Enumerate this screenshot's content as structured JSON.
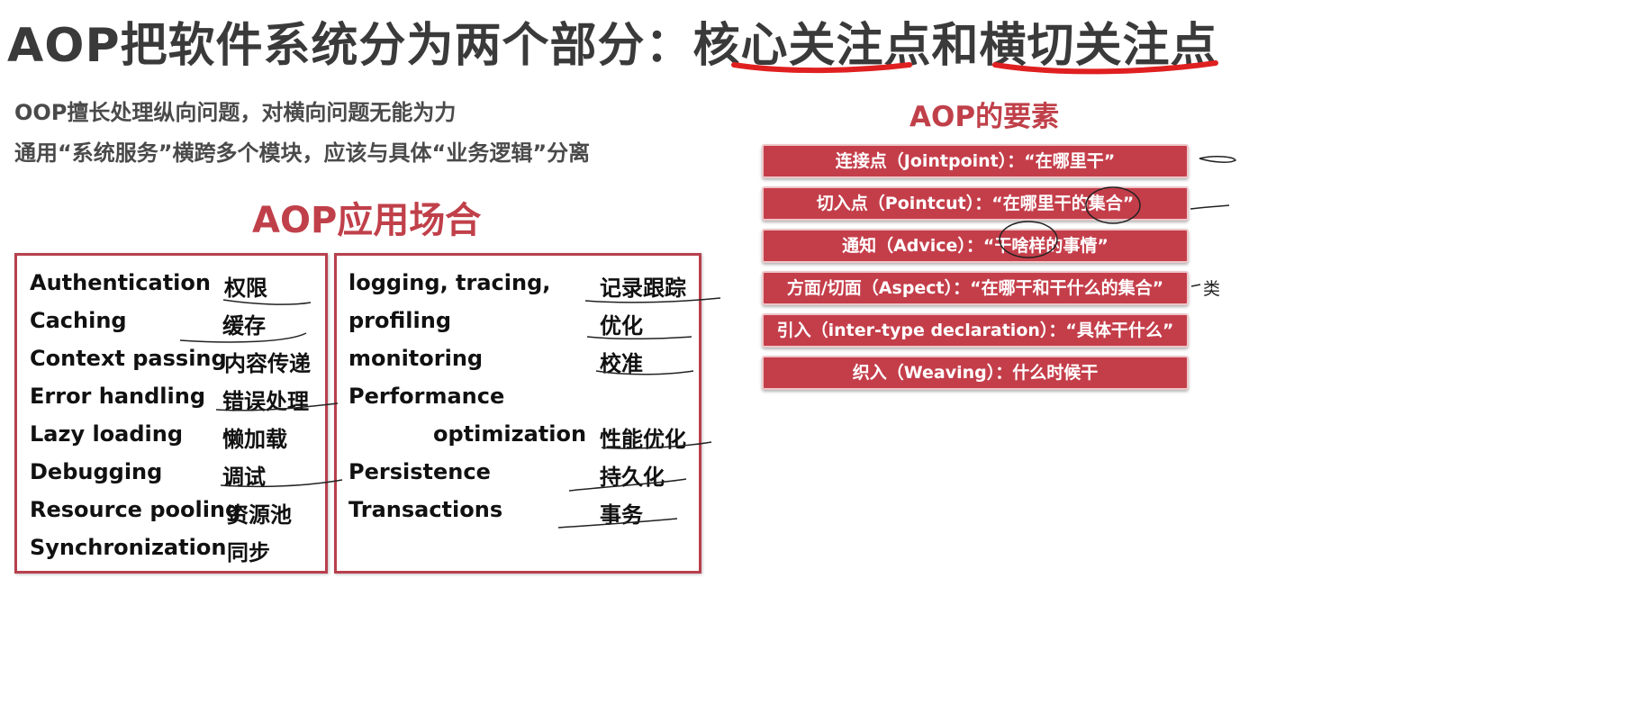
{
  "title": "AOP把软件系统分为两个部分：核心关注点和横切关注点",
  "intro": [
    "OOP擅长处理纵向问题，对横向问题无能为力",
    "通用“系统服务”横跨多个模块，应该与具体“业务逻辑”分离"
  ],
  "applications": {
    "heading": "AOP应用场合",
    "left": [
      {
        "en": "Authentication",
        "cn": "权限"
      },
      {
        "en": "Caching",
        "cn": "缓存"
      },
      {
        "en": "Context passing",
        "cn": "内容传递"
      },
      {
        "en": "Error handling",
        "cn": "错误处理"
      },
      {
        "en": "Lazy loading",
        "cn": "懒加载"
      },
      {
        "en": "Debugging",
        "cn": "调试"
      },
      {
        "en": "Resource pooling",
        "cn": "资源池"
      },
      {
        "en": "Synchronization",
        "cn": "同步"
      }
    ],
    "right": [
      {
        "en": "logging, tracing,",
        "cn": "记录跟踪"
      },
      {
        "en": "profiling",
        "cn": "优化"
      },
      {
        "en": "monitoring",
        "cn": "校准"
      },
      {
        "en": "Performance",
        "cn": ""
      },
      {
        "en": "optimization",
        "cn": "性能优化"
      },
      {
        "en": "Persistence",
        "cn": "持久化"
      },
      {
        "en": "Transactions",
        "cn": "事务"
      }
    ]
  },
  "elements": {
    "heading": "AOP的要素",
    "items": [
      "连接点（Jointpoint）：“在哪里干”",
      "切入点（Pointcut）：“在哪里干的集合”",
      "通知（Advice）：“干啥样的事情”",
      "方面/切面（Aspect）：“在哪干和干什么的集合”",
      "引入（inter-type declaration）：“具体干什么”",
      "织入（Weaving）：什么时候干"
    ],
    "side_note": "类"
  },
  "colors": {
    "accent": "#c0404a",
    "pill_bg": "#c43e4a",
    "title": "#3a3a3a",
    "underline": "#e02020"
  }
}
